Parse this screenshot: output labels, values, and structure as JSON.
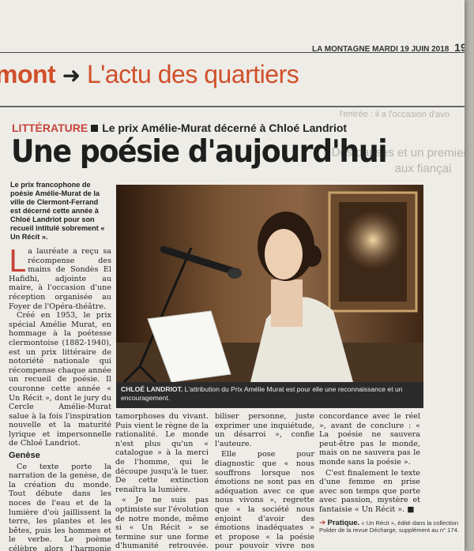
{
  "bleed_through": [
    "l'entrée : il a l'occasion d'avo",
    "de l'apprendre",
    "...",
    "Des danses et un premier",
    "aux fiançai"
  ],
  "header": {
    "paper": "LA MONTAGNE",
    "date": "MARDI 19 JUIN 2018",
    "page_number": "19"
  },
  "rubric": {
    "part1": "mont",
    "arrow": "➜",
    "part2": "L'actu des quartiers"
  },
  "kicker": {
    "label": "LITTÉRATURE",
    "text": "Le prix Amélie-Murat décerné à Chloé Landriot"
  },
  "headline": "Une poésie d'aujourd'hui",
  "chapo": "Le prix francophone de poésie Amélie-Murat de la ville de Clermont-Ferrand est décerné cette année à Chloé Landriot pour son recueil intitulé sobrement « Un Récit ».",
  "photo": {
    "caption_name": "CHLOÉ LANDRIOT.",
    "caption_text": " L'attribution du Prix Amélie Murat est pour elle une reconnaissance et un encouragement."
  },
  "colors": {
    "accent_red": "#c6443a",
    "rubric_orange": "#d0502a",
    "paper": "#eeece7"
  },
  "col1": {
    "dropcap": "L",
    "p1": "a lauréate a reçu sa récompense des mains de Sondès El Hafidhi, adjointe au maire, à l'occasion d'une réception organisée au Foyer de l'Opéra-théâtre.",
    "p2": "Créé en 1953, le prix spécial Amélie Murat, en hommage à la poétesse clermontoise (1882-1940), est un prix littéraire de notoriété nationale qui récompense chaque année un recueil de poésie. Il couronne cette année « Un Récit », dont le jury du Cercle Amélie-Murat salue à la fois l'inspiration nouvelle et la maturité lyrique et impersonnelle de Chloé Landriot.",
    "subhead": "Genèse",
    "p3": "Ce texte porte la narration de la genèse, de la création du monde. Tout débute dans les noces de l'eau et de la lumière d'où jaillissent la terre, les plantes et les bêtes, puis les hommes et le verbe. Le poème célèbre alors l'harmonie heureuse et les mé-"
  },
  "col2": {
    "p1": "tamorphoses du vivant. Puis vient le règne de la rationalité. Le monde n'est plus qu'un « catalogue » à la merci de l'homme, qui le découpe jusqu'à le tuer. De cette extinction renaîtra la lumière.",
    "p2": "« Je ne suis pas optimiste sur l'évolution de notre monde, même si « Un Récit » se termine sur une forme d'humanité retrouvée. Je ne souhaite culpa-"
  },
  "col3": {
    "p1": "biliser personne, juste exprimer une inquiétude, un désarroi », confie l'auteure.",
    "p2": "Elle pose pour diagnostic que « nous souffrons lorsque nos émotions ne sont pas en adéquation avec ce que nous vivons », regrette que « la société nous enjoint d'avoir des émotions inadéquates » et propose « la poésie pour pouvoir vivre nos émotions en"
  },
  "col4": {
    "p1": "concordance avec le réel », avant de conclure : « La poésie ne sauvera peut-être pas le monde, mais on ne sauvera pas le monde sans la poésie ».",
    "p2": "C'est finalement le texte d'une femme en prise avec son temps que porte avec passion, mystère et fantaisie « Un Récit ». ■"
  },
  "pratique": {
    "label": "Pratique.",
    "text": " « Un Récit », édité dans la collection Polder de la revue Décharge, supplément au n° 174."
  }
}
